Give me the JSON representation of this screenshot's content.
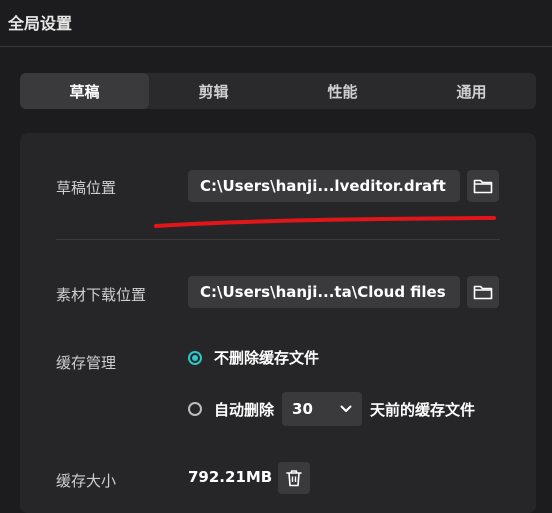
{
  "window": {
    "title": "全局设置"
  },
  "tabs": [
    {
      "label": "草稿",
      "active": true
    },
    {
      "label": "剪辑",
      "active": false
    },
    {
      "label": "性能",
      "active": false
    },
    {
      "label": "通用",
      "active": false
    }
  ],
  "draft": {
    "label": "草稿位置",
    "path": "C:\\Users\\hanji...lveditor.draft"
  },
  "material": {
    "label": "素材下载位置",
    "path": "C:\\Users\\hanji...ta\\Cloud files"
  },
  "cache": {
    "label": "缓存管理",
    "option1": "不删除缓存文件",
    "option2_prefix": "自动删除",
    "days": "30",
    "option2_suffix": "天前的缓存文件"
  },
  "cache_size": {
    "label": "缓存大小",
    "value": "792.21MB"
  },
  "colors": {
    "accent": "#2ec7c9",
    "annotation": "#e0161b"
  }
}
